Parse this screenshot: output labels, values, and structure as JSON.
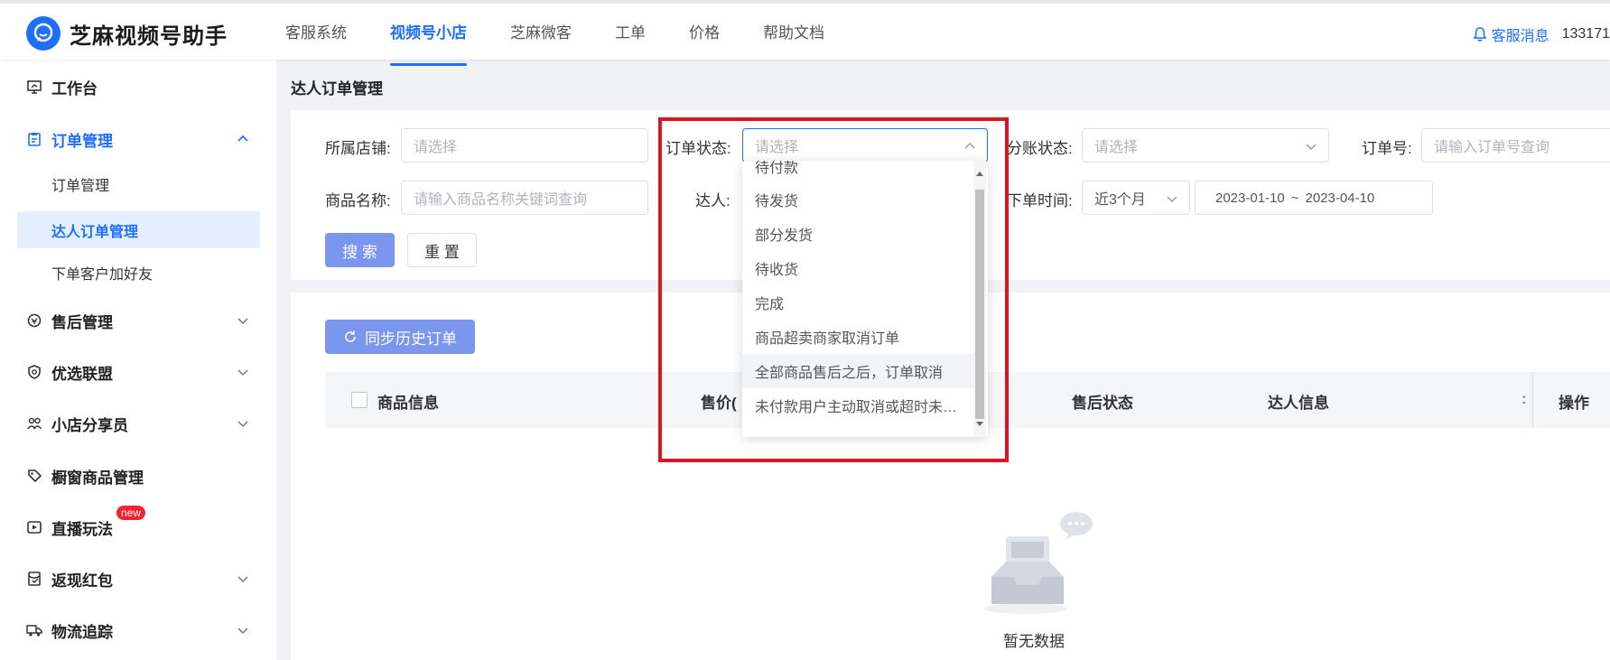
{
  "app": {
    "name": "芝麻视频号助手"
  },
  "topnav": {
    "items": [
      {
        "label": "客服系统",
        "active": false
      },
      {
        "label": "视频号小店",
        "active": true
      },
      {
        "label": "芝麻微客",
        "active": false
      },
      {
        "label": "工单",
        "active": false
      },
      {
        "label": "价格",
        "active": false
      },
      {
        "label": "帮助文档",
        "active": false
      }
    ],
    "message_label": "客服消息",
    "user_phone": "133171"
  },
  "sidebar": {
    "items": [
      {
        "label": "工作台",
        "icon": "monitor-icon"
      },
      {
        "label": "订单管理",
        "icon": "clipboard-icon",
        "expanded": true
      },
      {
        "label": "售后管理",
        "icon": "refund-icon"
      },
      {
        "label": "优选联盟",
        "icon": "shield-icon"
      },
      {
        "label": "小店分享员",
        "icon": "people-icon"
      },
      {
        "label": "橱窗商品管理",
        "icon": "tag-icon"
      },
      {
        "label": "直播玩法",
        "icon": "play-icon",
        "badge": "new"
      },
      {
        "label": "返现红包",
        "icon": "redpacket-icon"
      },
      {
        "label": "物流追踪",
        "icon": "truck-icon"
      }
    ],
    "sub_items": [
      {
        "label": "订单管理",
        "active": false
      },
      {
        "label": "达人订单管理",
        "active": true
      },
      {
        "label": "下单客户加好友",
        "active": false
      }
    ]
  },
  "page": {
    "title": "达人订单管理"
  },
  "filters": {
    "shop_label": "所属店铺:",
    "shop_placeholder": "请选择",
    "order_status_label": "订单状态:",
    "order_status_placeholder": "请选择",
    "split_status_label": "分账状态:",
    "split_status_placeholder": "请选择",
    "order_no_label": "订单号:",
    "order_no_placeholder": "请输入订单号查询",
    "product_name_label": "商品名称:",
    "product_name_placeholder": "请输入商品名称关键词查询",
    "talent_label": "达人:",
    "order_time_label": "下单时间:",
    "time_range_value": "近3个月",
    "date_start": "2023-01-10",
    "date_sep": "~",
    "date_end": "2023-04-10",
    "search_button": "搜 索",
    "reset_button": "重 置"
  },
  "list": {
    "sync_button": "同步历史订单",
    "columns": [
      "商品信息",
      "售价(元",
      "售后状态",
      "达人信息",
      "操作"
    ],
    "empty_text": "暂无数据"
  },
  "dropdown": {
    "options": [
      "待付款",
      "待发货",
      "部分发货",
      "待收货",
      "完成",
      "商品超卖商家取消订单",
      "全部商品售后之后，订单取消",
      "未付款用户主动取消或超时未付款订单取消"
    ],
    "hovered_index": 6
  },
  "colors": {
    "accent": "#1e6fff",
    "primary_button": "#7b96ee",
    "highlight": "#e0141e",
    "badge": "#f5222d"
  }
}
